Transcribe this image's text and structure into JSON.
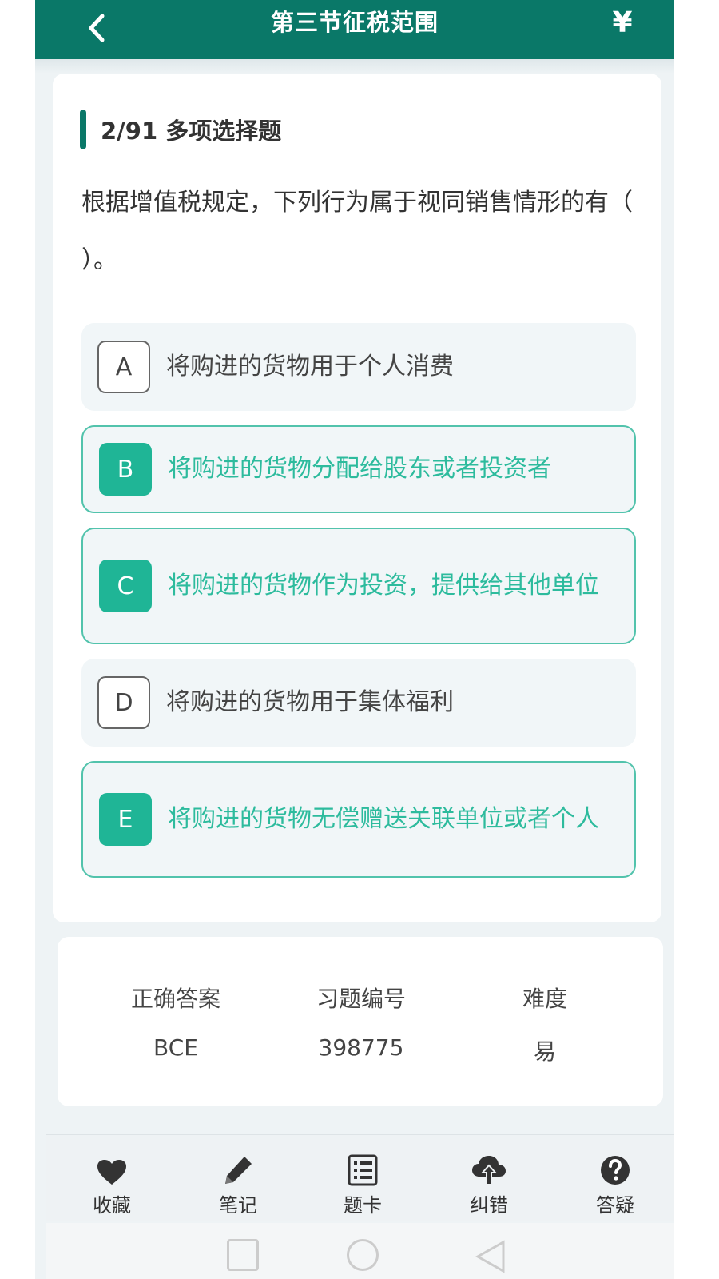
{
  "header": {
    "title": "第三节征税范围",
    "back_icon": "chevron-left-icon",
    "right_icon": "yen-icon",
    "right_glyph": "¥"
  },
  "question": {
    "progress_type": "2/91 多项选择题",
    "text": "根据增值税规定，下列行为属于视同销售情形的有（ ）。",
    "options": [
      {
        "letter": "A",
        "text": "将购进的货物用于个人消费",
        "selected": false
      },
      {
        "letter": "B",
        "text": "将购进的货物分配给股东或者投资者",
        "selected": true
      },
      {
        "letter": "C",
        "text": "将购进的货物作为投资，提供给其他单位",
        "selected": true
      },
      {
        "letter": "D",
        "text": "将购进的货物用于集体福利",
        "selected": false
      },
      {
        "letter": "E",
        "text": "将购进的货物无偿赠送关联单位或者个人",
        "selected": true
      }
    ]
  },
  "answer": {
    "correct_label": "正确答案",
    "correct_value": "BCE",
    "id_label": "习题编号",
    "id_value": "398775",
    "difficulty_label": "难度",
    "difficulty_value": "易"
  },
  "tabbar": {
    "items": [
      {
        "label": "收藏",
        "icon": "heart-icon"
      },
      {
        "label": "笔记",
        "icon": "pencil-icon"
      },
      {
        "label": "题卡",
        "icon": "list-card-icon"
      },
      {
        "label": "纠错",
        "icon": "cloud-upload-icon"
      },
      {
        "label": "答疑",
        "icon": "question-icon"
      }
    ]
  },
  "colors": {
    "header": "#0a7868",
    "accent": "#1fb596",
    "selected_text": "#2dbb9d"
  }
}
